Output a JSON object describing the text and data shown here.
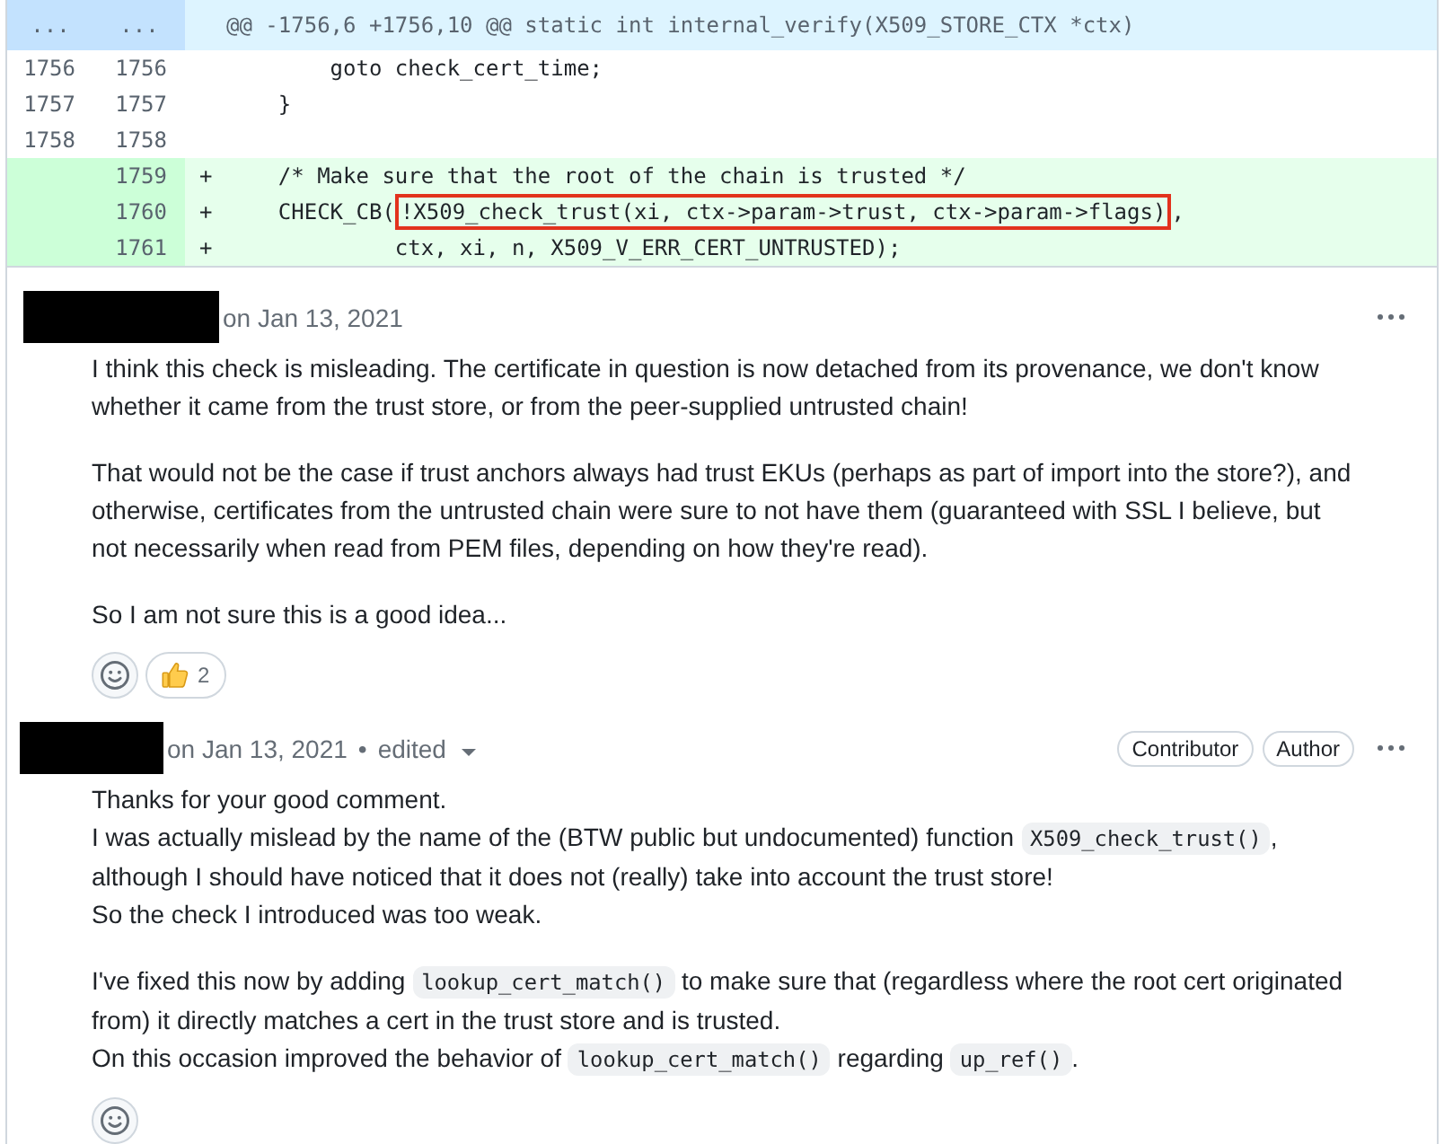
{
  "diff": {
    "hunk": {
      "old_marker": "...",
      "new_marker": "...",
      "header": "@@ -1756,6 +1756,10 @@ static int internal_verify(X509_STORE_CTX *ctx)"
    },
    "lines": [
      {
        "kind": "context",
        "old": "1756",
        "new": "1756",
        "segments": [
          {
            "text": "        goto check_cert_time;",
            "highlighted": false
          }
        ]
      },
      {
        "kind": "context",
        "old": "1757",
        "new": "1757",
        "segments": [
          {
            "text": "    }",
            "highlighted": false
          }
        ]
      },
      {
        "kind": "context",
        "old": "1758",
        "new": "1758"
      },
      {
        "kind": "added",
        "new": "1759",
        "marker": "+",
        "segments": [
          {
            "text": "    /* Make sure that the root of the chain is trusted */",
            "highlighted": false
          }
        ]
      },
      {
        "kind": "added",
        "new": "1760",
        "marker": "+",
        "segments": [
          {
            "text": "    CHECK_CB(",
            "highlighted": false
          },
          {
            "text": "!X509_check_trust(xi, ctx->param->trust, ctx->param->flags)",
            "highlighted": true
          },
          {
            "text": ",",
            "highlighted": false
          }
        ]
      },
      {
        "kind": "added",
        "new": "1761",
        "marker": "+",
        "segments": [
          {
            "text": "             ctx, xi, n, X509_V_ERR_CERT_UNTRUSTED);",
            "highlighted": false
          }
        ]
      }
    ]
  },
  "comments": [
    {
      "date": "on Jan 13, 2021",
      "paragraphs": [
        {
          "lines": [
            [
              {
                "kind": "text",
                "text": "I think this check is misleading. The certificate in question is now detached from its provenance, we don't know"
              }
            ],
            [
              {
                "kind": "text",
                "text": "whether it came from the trust store, or from the peer-supplied untrusted chain!"
              }
            ]
          ]
        },
        {
          "lines": [
            [
              {
                "kind": "text",
                "text": "That would not be the case if trust anchors always had trust EKUs (perhaps as part of import into the store?), and"
              }
            ],
            [
              {
                "kind": "text",
                "text": "otherwise, certificates from the untrusted chain were sure to not have them (guaranteed with SSL I believe, but"
              }
            ],
            [
              {
                "kind": "text",
                "text": "not necessarily when read from PEM files, depending on how they're read)."
              }
            ]
          ]
        },
        {
          "lines": [
            [
              {
                "kind": "text",
                "text": "So I am not sure this is a good idea..."
              }
            ]
          ]
        }
      ],
      "reactions": [
        {
          "kind": "thumbs_up",
          "count": "2"
        }
      ]
    },
    {
      "date": "on Jan 13, 2021",
      "separator": "•",
      "edited": "edited",
      "badges": [
        "Contributor",
        "Author"
      ],
      "paragraphs": [
        {
          "lines": [
            [
              {
                "kind": "text",
                "text": "Thanks for your good comment."
              }
            ],
            [
              {
                "kind": "text",
                "text": "I was actually mislead by the name of the (BTW public but undocumented) function "
              },
              {
                "kind": "code",
                "text": "X509_check_trust()"
              },
              {
                "kind": "text",
                "text": ","
              }
            ],
            [
              {
                "kind": "text",
                "text": "although I should have noticed that it does not (really) take into account the trust store!"
              }
            ],
            [
              {
                "kind": "text",
                "text": "So the check I introduced was too weak."
              }
            ]
          ]
        },
        {
          "lines": [
            [
              {
                "kind": "text",
                "text": "I've fixed this now by adding "
              },
              {
                "kind": "code",
                "text": "lookup_cert_match()"
              },
              {
                "kind": "text",
                "text": " to make sure that (regardless where the root cert originated"
              }
            ],
            [
              {
                "kind": "text",
                "text": "from) it directly matches a cert in the trust store and is trusted."
              }
            ],
            [
              {
                "kind": "text",
                "text": "On this occasion improved the behavior of "
              },
              {
                "kind": "code",
                "text": "lookup_cert_match()"
              },
              {
                "kind": "text",
                "text": " regarding "
              },
              {
                "kind": "code",
                "text": "up_ref()"
              },
              {
                "kind": "text",
                "text": "."
              }
            ]
          ]
        }
      ]
    }
  ]
}
